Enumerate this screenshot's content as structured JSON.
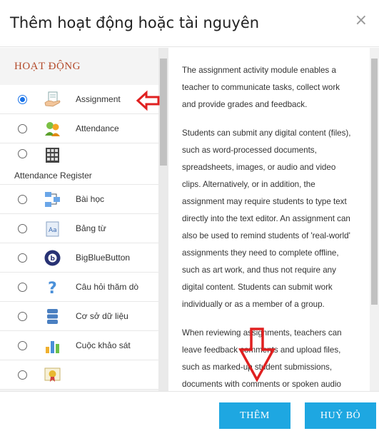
{
  "dialog": {
    "title": "Thêm hoạt động hoặc tài nguyên",
    "close_glyph": "×"
  },
  "activities": {
    "section_title": "HOẠT ĐỘNG",
    "items": [
      {
        "label": "Assignment",
        "icon": "assignment-hand-icon",
        "selected": true
      },
      {
        "label": "Attendance",
        "icon": "attendance-people-icon",
        "selected": false
      },
      {
        "label": "Attendance Register",
        "icon": "attendance-register-icon",
        "selected": false
      },
      {
        "label": "Bài học",
        "icon": "lesson-flowchart-icon",
        "selected": false
      },
      {
        "label": "Bảng từ",
        "icon": "glossary-book-icon",
        "selected": false
      },
      {
        "label": "BigBlueButton",
        "icon": "bigbluebutton-icon",
        "selected": false
      },
      {
        "label": "Câu hỏi thăm dò",
        "icon": "question-mark-icon",
        "selected": false
      },
      {
        "label": "Cơ sở dữ liệu",
        "icon": "database-icon",
        "selected": false
      },
      {
        "label": "Cuộc khảo sát",
        "icon": "survey-chart-icon",
        "selected": false
      },
      {
        "label": "",
        "icon": "certificate-icon",
        "selected": false
      }
    ]
  },
  "description": {
    "paragraphs": [
      "The assignment activity module enables a teacher to communicate tasks, collect work and provide grades and feedback.",
      "Students can submit any digital content (files), such as word-processed documents, spreadsheets, images, or audio and video clips. Alternatively, or in addition, the assignment may require students to type text directly into the text editor. An assignment can also be used to remind students of 'real-world' assignments they need to complete offline, such as art work, and thus not require any digital content. Students can submit work individually or as a member of a group.",
      "When reviewing assignments, teachers can leave feedback comments and upload files, such as marked-up student submissions, documents with comments or spoken audio"
    ]
  },
  "footer": {
    "add_label": "THÊM",
    "cancel_label": "HUỶ BỎ"
  },
  "colors": {
    "accent": "#1ea7e1",
    "section_title": "#b34a2a",
    "annotation_arrow": "#e02020"
  }
}
